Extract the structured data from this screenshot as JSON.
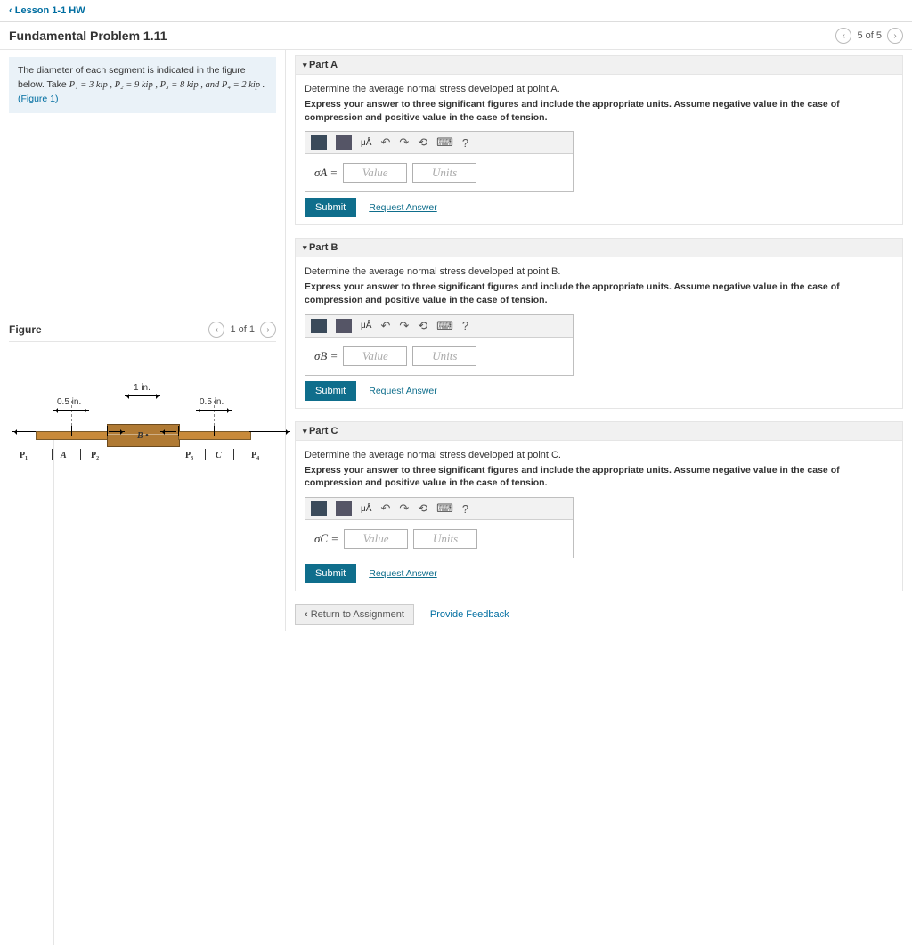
{
  "nav": {
    "back_label": "Lesson 1-1 HW"
  },
  "header": {
    "title": "Fundamental Problem 1.11",
    "pager_text": "5 of 5"
  },
  "info": {
    "text_before": "The diameter of each segment is indicated in the figure below. Take ",
    "eq": "P₁ = 3 kip , P₂ = 9 kip , P₃ = 8 kip , and P₄ = 2 kip .",
    "figure_link": "(Figure 1)"
  },
  "figure": {
    "title": "Figure",
    "pager": "1 of 1",
    "dims": {
      "left": "0.5 in.",
      "mid": "1 in.",
      "right": "0.5 in."
    },
    "labels": {
      "P1": "P₁",
      "A": "A",
      "P2": "P₂",
      "B": "B",
      "P3": "P₃",
      "C": "C",
      "P4": "P₄",
      "Bdot": "B •"
    }
  },
  "common": {
    "value_ph": "Value",
    "units_ph": "Units",
    "submit": "Submit",
    "request": "Request Answer",
    "tool_mu": "μÅ",
    "tool_q": "?",
    "express": "Express your answer to three significant figures and include the appropriate units. Assume negative value in the case of compression and positive value in the case of tension."
  },
  "parts": {
    "A": {
      "title": "Part A",
      "prompt": "Determine the average normal stress developed at point A.",
      "sigma": "σA ="
    },
    "B": {
      "title": "Part B",
      "prompt": "Determine the average normal stress developed at point B.",
      "sigma": "σB ="
    },
    "C": {
      "title": "Part C",
      "prompt": "Determine the average normal stress developed at point C.",
      "sigma": "σC ="
    }
  },
  "footer": {
    "return": "Return to Assignment",
    "feedback": "Provide Feedback"
  }
}
